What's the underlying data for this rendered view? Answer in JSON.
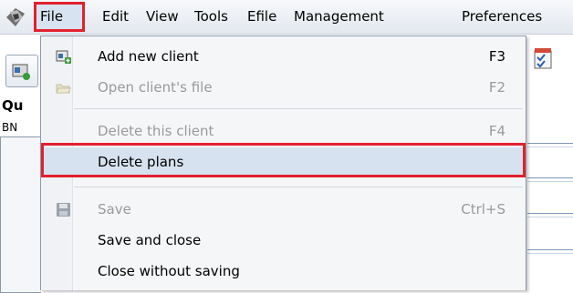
{
  "menubar": {
    "items": [
      "File",
      "Edit",
      "View",
      "Tools",
      "Efile",
      "Management",
      "Preferences"
    ]
  },
  "background": {
    "qu_label": "Qu",
    "bn_label": "BN"
  },
  "file_menu": {
    "items": [
      {
        "label": "Add new client",
        "shortcut": "F3",
        "enabled": true,
        "icon": "add-client-icon"
      },
      {
        "label": "Open client's file",
        "shortcut": "F2",
        "enabled": false,
        "icon": "open-folder-icon"
      },
      {
        "label": "Delete this client",
        "shortcut": "F4",
        "enabled": false,
        "icon": ""
      },
      {
        "label": "Delete plans",
        "shortcut": "",
        "enabled": true,
        "icon": "",
        "highlighted": true
      },
      {
        "label": "Save",
        "shortcut": "Ctrl+S",
        "enabled": false,
        "icon": "save-icon"
      },
      {
        "label": "Save and close",
        "shortcut": "",
        "enabled": true,
        "icon": ""
      },
      {
        "label": "Close without saving",
        "shortcut": "",
        "enabled": true,
        "icon": ""
      }
    ]
  },
  "colors": {
    "annotation_red": "#e0212e",
    "selection_blue": "#d6e2ef"
  }
}
